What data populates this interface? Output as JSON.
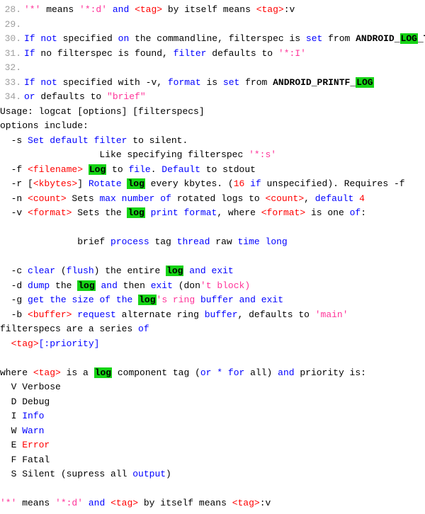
{
  "lines": {
    "28": "28.",
    "29": "29.",
    "30": "30.",
    "31": "31.",
    "32": "32.",
    "33": "33.",
    "34": "34."
  },
  "code": {
    "28": {
      "a": "'*'",
      "b": " means ",
      "c": "'*:d'",
      "d": " ",
      "e": "and",
      "f": " ",
      "g": "<tag>",
      "h": " by itself means ",
      "i": "<tag>",
      "j": ":v"
    },
    "30": {
      "a": "If",
      "b": " ",
      "c": "not",
      "d": " specified ",
      "e": "on",
      "f": " the commandline, filterspec is ",
      "g": "set",
      "h": " from ",
      "i": "ANDROID",
      "j": "_",
      "k": "LOG",
      "l": "_TAG"
    },
    "31": {
      "a": "If",
      "b": " no filterspec is found, ",
      "c": "filter",
      "d": " defaults to ",
      "e": "'*:I'"
    },
    "33": {
      "a": "If",
      "b": " ",
      "c": "not",
      "d": " specified with -v, ",
      "e": "format",
      "f": " is ",
      "g": "set",
      "h": " from ",
      "i": "ANDROID",
      "j": "_PRINTF_",
      "k": "LOG"
    },
    "34": {
      "a": "or",
      "b": " defaults to ",
      "c": "\"brief\""
    },
    "usage": "Usage: logcat [options] [filterspecs]",
    "options": "options include:",
    "s1a": "  -s ",
    "s1b": "Set",
    "s1c": " ",
    "s1d": "default",
    "s1e": " ",
    "s1f": "filter",
    "s1g": " to silent.",
    "s2a": "                  Like specifying filterspec ",
    "s2b": "'*:s'",
    "f1a": "  -f ",
    "f1b": "<filename>",
    "f1c": " ",
    "f1d": "Log",
    "f1e": " to ",
    "f1f": "file",
    "f1g": ". ",
    "f1h": "Default",
    "f1i": " to stdout",
    "r1a": "  -r [",
    "r1b": "<kbytes>",
    "r1c": "] ",
    "r1d": "Rotate",
    "r1e": " ",
    "r1f": "log",
    "r1g": " every kbytes. (",
    "r1h": "16",
    "r1i": " ",
    "r1j": "if",
    "r1k": " unspecified). Requires -f",
    "n1a": "  -n ",
    "n1b": "<count>",
    "n1c": " Sets ",
    "n1d": "max",
    "n1e": " ",
    "n1f": "number",
    "n1g": " ",
    "n1h": "of",
    "n1i": " rotated logs to ",
    "n1j": "<count>",
    "n1k": ", ",
    "n1l": "default",
    "n1m": " ",
    "n1n": "4",
    "v1a": "  -v ",
    "v1b": "<format>",
    "v1c": " Sets the ",
    "v1d": "log",
    "v1e": " ",
    "v1f": "print",
    "v1g": " ",
    "v1h": "format",
    "v1i": ", where ",
    "v1j": "<format>",
    "v1k": " is one ",
    "v1l": "of",
    "v1m": ":",
    "fmt1a": "              brief ",
    "fmt1b": "process",
    "fmt1c": " tag ",
    "fmt1d": "thread",
    "fmt1e": " raw ",
    "fmt1f": "time",
    "fmt1g": " ",
    "fmt1h": "long",
    "c1a": "  -c ",
    "c1b": "clear",
    "c1c": " (",
    "c1d": "flush",
    "c1e": ") the entire ",
    "c1f": "log",
    "c1g": " ",
    "c1h": "and",
    "c1i": " ",
    "c1j": "exit",
    "d1a": "  -d ",
    "d1b": "dump",
    "d1c": " the ",
    "d1d": "log",
    "d1e": " ",
    "d1f": "and",
    "d1g": " then ",
    "d1h": "exit",
    "d1i": " (don",
    "d1j": "'t block)",
    "g1a": "  -g ",
    "g1b": "get",
    "g1c": " ",
    "g1d": "the",
    "g1e": " ",
    "g1f": "size",
    "g1g": " ",
    "g1h": "of",
    "g1i": " ",
    "g1j": "the",
    "g1k": " ",
    "g1l": "log",
    "g1m": "'s ring ",
    "g1n": "buffer",
    "g1o": " ",
    "g1p": "and",
    "g1q": " ",
    "g1r": "exit",
    "b1a": "  -b ",
    "b1b": "<buffer>",
    "b1c": " ",
    "b1d": "request",
    "b1e": " alternate ring ",
    "b1f": "buffer",
    "b1g": ", defaults to ",
    "b1h": "'main'",
    "fs1a": "filterspecs are a series ",
    "fs1b": "of",
    "fs2a": "  ",
    "fs2b": "<tag>",
    "fs2c": "[:priority]",
    "wh1a": "where ",
    "wh1b": "<tag>",
    "wh1c": " is a ",
    "wh1d": "log",
    "wh1e": " component tag (",
    "wh1f": "or",
    "wh1g": " ",
    "wh1h": "*",
    "wh1i": " ",
    "wh1j": "for",
    "wh1k": " all) ",
    "wh1l": "and",
    "wh1m": " priority is:",
    "pV": "  V Verbose",
    "pD": "  D Debug",
    "pI1": "  I ",
    "pI2": "Info",
    "pW1": "  W ",
    "pW2": "Warn",
    "pE1": "  E ",
    "pE2": "Error",
    "pF": "  F Fatal",
    "pS1": "  S Silent (supress all ",
    "pS2": "output",
    "pS3": ")",
    "last1": "'*'",
    "last2": " means ",
    "last3": "'*:d'",
    "last4": " ",
    "last5": "and",
    "last6": " ",
    "last7": "<tag>",
    "last8": " by itself means ",
    "last9": "<tag>",
    "last10": ":v"
  }
}
